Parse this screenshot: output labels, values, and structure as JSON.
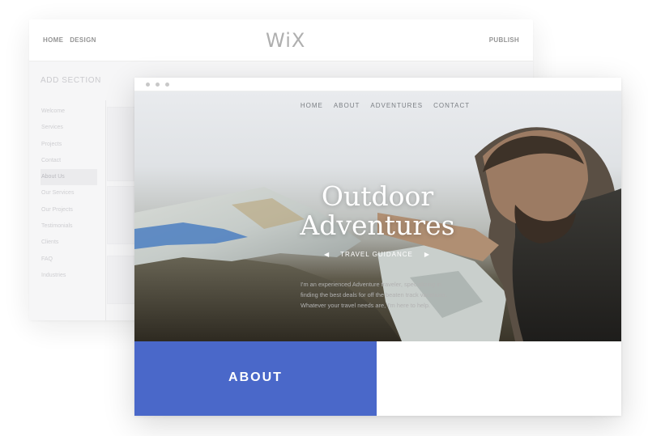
{
  "editor": {
    "nav": [
      "HOME",
      "DESIGN"
    ],
    "logo": "WiX",
    "publish_label": "PUBLISH",
    "add_section_label": "ADD SECTION",
    "sidebar_items": [
      {
        "label": "Welcome",
        "active": false
      },
      {
        "label": "Services",
        "active": false
      },
      {
        "label": "Projects",
        "active": false
      },
      {
        "label": "Contact",
        "active": false
      },
      {
        "label": "About Us",
        "active": true
      },
      {
        "label": "Our Services",
        "active": false
      },
      {
        "label": "Our Projects",
        "active": false
      },
      {
        "label": "Testimonials",
        "active": false
      },
      {
        "label": "Clients",
        "active": false
      },
      {
        "label": "FAQ",
        "active": false
      },
      {
        "label": "Industries",
        "active": false
      }
    ]
  },
  "site": {
    "nav": [
      "HOME",
      "ABOUT",
      "ADVENTURES",
      "CONTACT"
    ],
    "hero_title_line1": "Outdoor",
    "hero_title_line2": "Adventures",
    "hero_subtitle": "TRAVEL GUIDANCE",
    "about_heading": "ABOUT",
    "about_text": "I'm an experienced Adventure traveler, specializing in finding the best deals for off the beaten track vacations. Whatever your travel needs are, I'm here to help."
  },
  "colors": {
    "accent_blue": "#4a68c9",
    "hero_text": "#ffffff",
    "editor_bg": "#f6f6f7"
  },
  "icons": {
    "prev_arrow": "arrow-left-icon",
    "next_arrow": "arrow-right-icon"
  }
}
